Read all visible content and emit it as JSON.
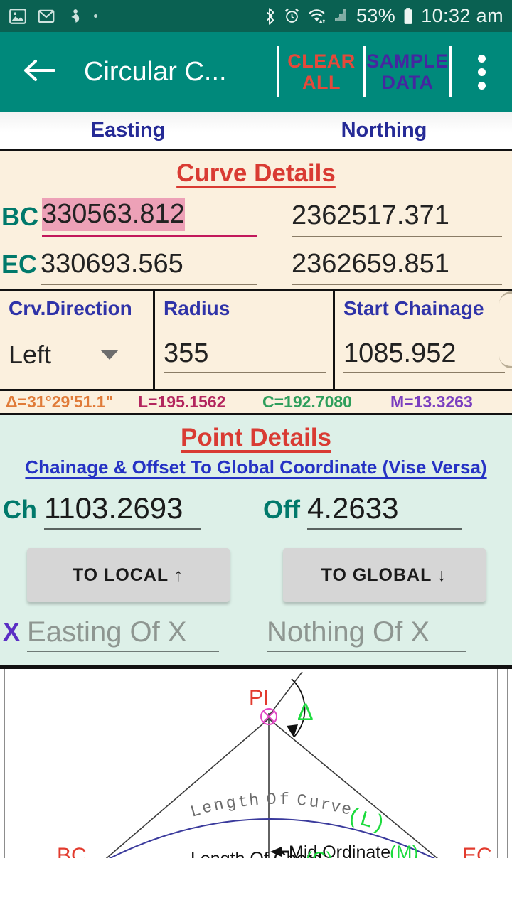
{
  "status_bar": {
    "icons_left": [
      "photos-icon",
      "gmail-icon",
      "person-icon",
      "dot-icon"
    ],
    "icons_right": [
      "bluetooth-icon",
      "alarm-icon",
      "wifi-icon",
      "signal-icon"
    ],
    "battery_percent": "53%",
    "time": "10:32 am"
  },
  "app_bar": {
    "back_icon": "back-arrow-icon",
    "title": "Circular C...",
    "clear_all": "CLEAR\nALL",
    "clear_all_line1": "CLEAR",
    "clear_all_line2": "ALL",
    "sample_data_line1": "SAMPLE",
    "sample_data_line2": "DATA",
    "overflow_icon": "more-vertical-icon",
    "accent_bg": "#00897b",
    "clear_color": "#e5493a",
    "sample_color": "#4527a0"
  },
  "columns": {
    "easting": "Easting",
    "northing": "Northing"
  },
  "curve_details": {
    "title": "Curve Details",
    "bc": {
      "label": "BC",
      "easting": "330563.812",
      "northing": "2362517.371",
      "easting_selected": true,
      "selection_color": "#eda1b7",
      "focus_underline_color": "#c2185b"
    },
    "ec": {
      "label": "EC",
      "easting": "330693.565",
      "northing": "2362659.851"
    },
    "params": [
      {
        "label": "Crv.Direction",
        "value": "Left",
        "type": "dropdown"
      },
      {
        "label": "Radius",
        "value": "355",
        "type": "text"
      },
      {
        "label": "Start Chainage",
        "value": "1085.952",
        "type": "text"
      }
    ],
    "results": [
      {
        "key": "delta",
        "text": "Δ=31°29'51.1\"",
        "color": "#e07b39"
      },
      {
        "key": "length",
        "text": "L=195.1562",
        "color": "#b3255e"
      },
      {
        "key": "chord",
        "text": "C=192.7080",
        "color": "#2e9e5b"
      },
      {
        "key": "mid_ordinate",
        "text": "M=13.3263",
        "color": "#7b3fbf"
      }
    ]
  },
  "point_details": {
    "title": "Point Details",
    "subtitle": "Chainage & Offset To Global Coordinate (Vise Versa)",
    "chainage": {
      "label": "Ch",
      "value": "1103.2693"
    },
    "offset": {
      "label": "Off",
      "value": "4.2633"
    },
    "buttons": [
      {
        "name": "to-local-button",
        "label": "TO LOCAL ↑"
      },
      {
        "name": "to-global-button",
        "label": "TO GLOBAL ↓"
      }
    ],
    "x_row": {
      "label": "X",
      "easting_placeholder": "Easting Of X",
      "northing_placeholder": "Nothing Of X",
      "easting_value": "",
      "northing_value": ""
    }
  },
  "diagram": {
    "labels": {
      "pi": "PI",
      "delta": "Δ",
      "length_of_curve": "Length Of Curve",
      "length_symbol": "(L)",
      "mid_ordinate": "Mid Ordinate",
      "mid_symbol": "(M)",
      "bc": "BC",
      "ec": "EC",
      "chord": "Chord",
      "chord_symbol": "(C)"
    }
  }
}
